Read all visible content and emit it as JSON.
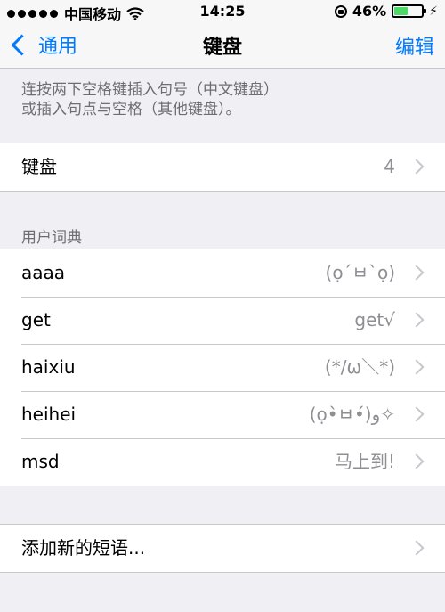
{
  "status_bar": {
    "carrier": "中国移动",
    "time": "14:25",
    "battery_percent": "46%",
    "battery_level": 0.46,
    "battery_color": "#4cd964"
  },
  "nav": {
    "back_label": "通用",
    "title": "键盘",
    "edit_label": "编辑",
    "accent_color": "#007aff"
  },
  "note": {
    "line1": "连按两下空格键插入句号（中文键盘）",
    "line2": "或插入句点与空格（其他键盘）。"
  },
  "keyboards_row": {
    "label": "键盘",
    "value": "4"
  },
  "dictionary": {
    "header": "用户词典",
    "entries": [
      {
        "shortcut": "aaaa",
        "phrase": "(ọ´ㅂ`ọ)"
      },
      {
        "shortcut": "get",
        "phrase": "get√"
      },
      {
        "shortcut": "haixiu",
        "phrase": "(*/ω＼*)"
      },
      {
        "shortcut": "heihei",
        "phrase": "(ọ•̀ㅂ•́)و✧"
      },
      {
        "shortcut": "msd",
        "phrase": "马上到!"
      }
    ]
  },
  "add_phrase": {
    "label": "添加新的短语..."
  }
}
